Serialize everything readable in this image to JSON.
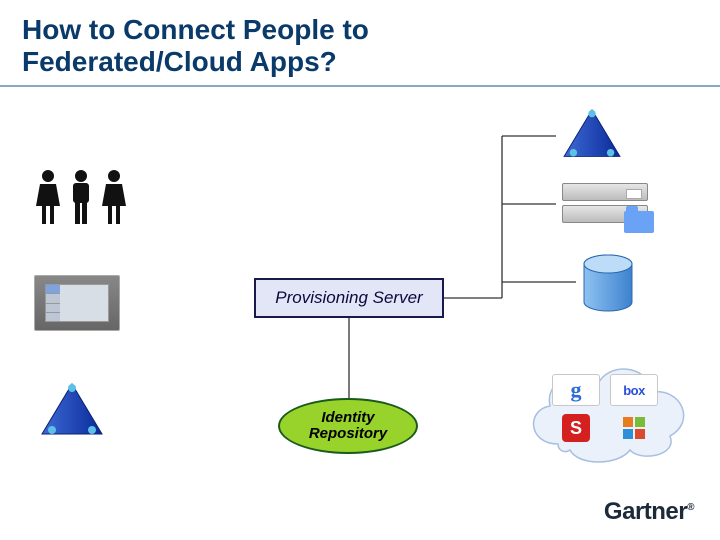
{
  "title_line1": "How to Connect People to",
  "title_line2": "Federated/Cloud Apps?",
  "provisioning_label": "Provisioning Server",
  "identity_repo_line1": "Identity",
  "identity_repo_line2": "Repository",
  "cloud_apps": {
    "google": "g",
    "box": "box",
    "socialcast": "S",
    "office": ""
  },
  "brand": "Gartner",
  "brand_mark": "®",
  "icons": {
    "people": "people-icon",
    "hr_system": "hr-system-icon",
    "directory_left": "directory-pyramid-icon",
    "directory_right_top": "directory-pyramid-icon",
    "servers": "server-stack-icon",
    "database": "database-icon",
    "cloud": "cloud-icon"
  },
  "colors": {
    "title": "#0a3a6a",
    "prov_border": "#1a1a4a",
    "prov_fill": "#e2e6f7",
    "idrepo_fill": "#97d32a",
    "idrepo_border": "#1a5a1a",
    "db": "#6aa8e8",
    "cloud_fill": "#eaf1fb"
  }
}
